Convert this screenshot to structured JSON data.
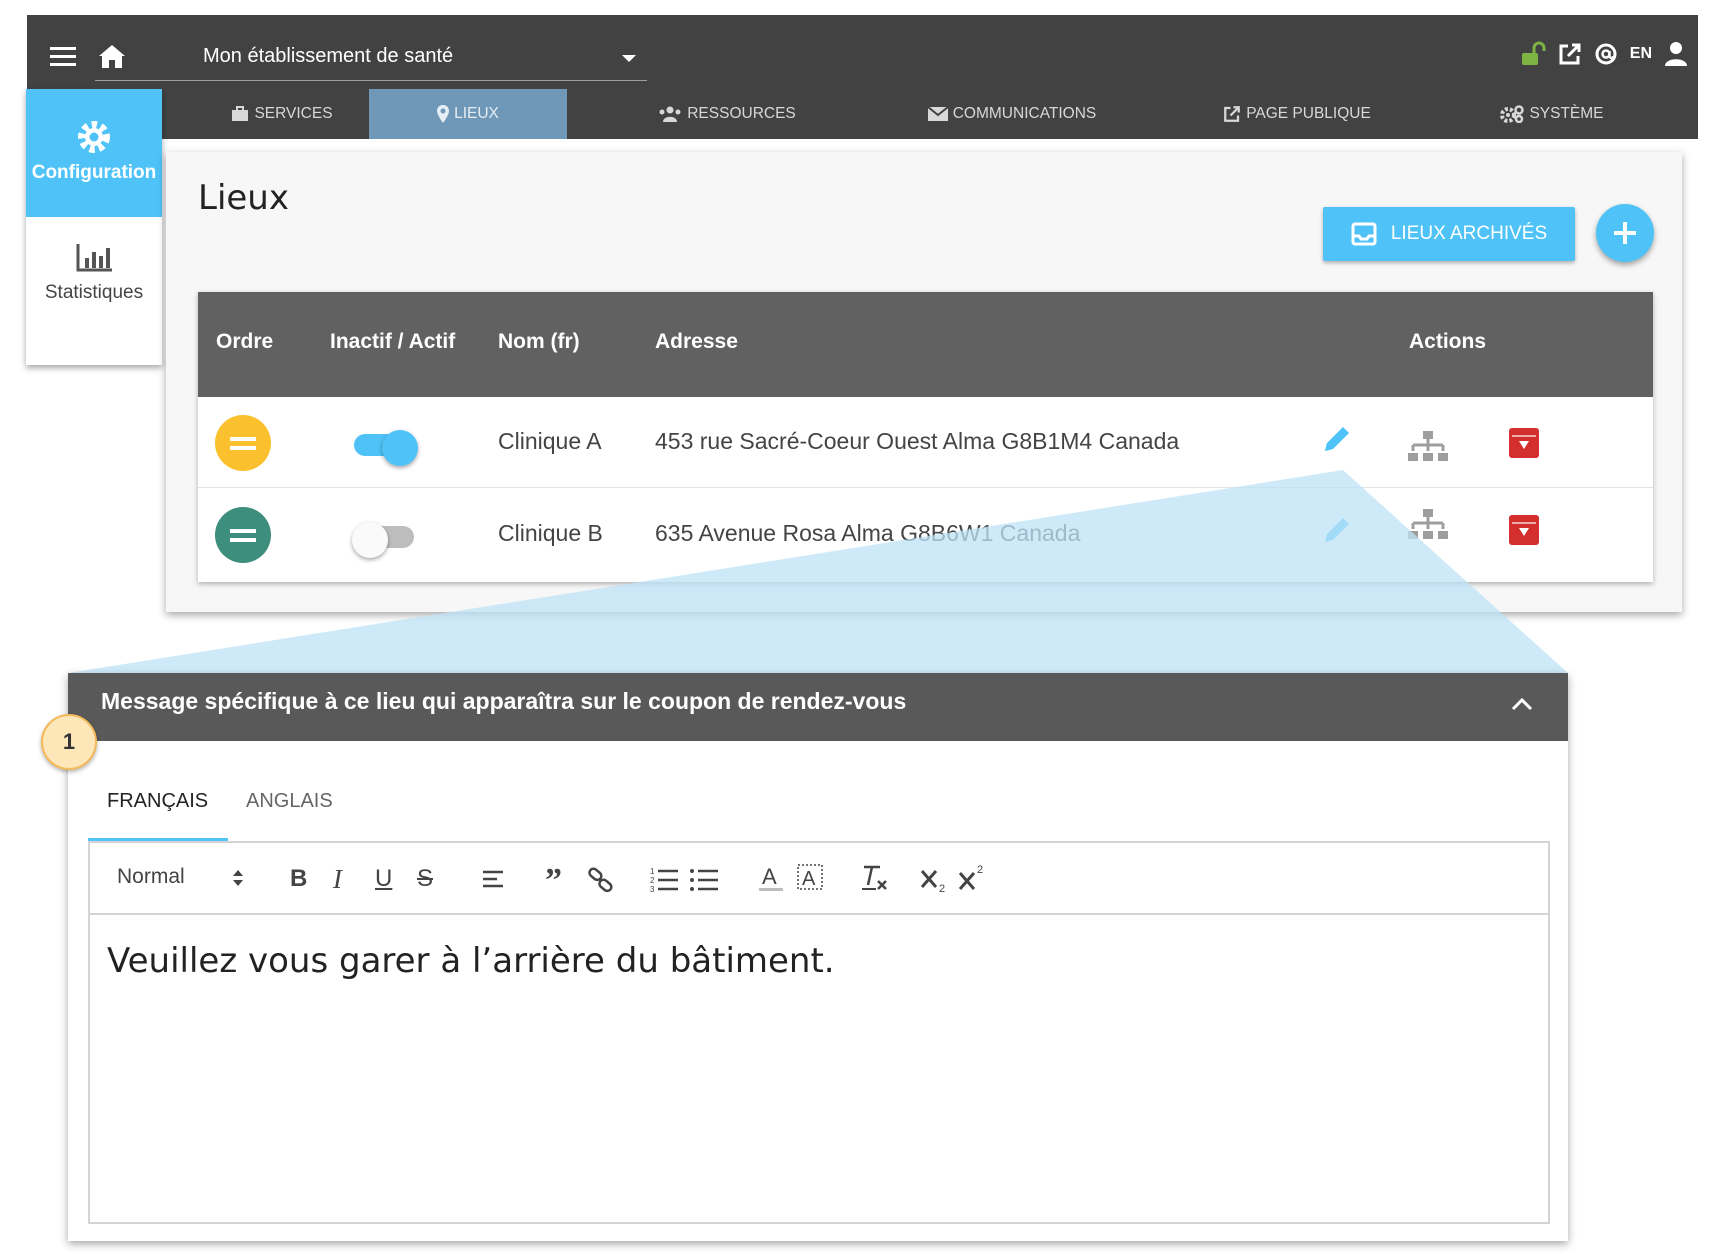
{
  "topbar": {
    "establishment": "Mon établissement de santé",
    "lang_button": "EN"
  },
  "tabs": [
    {
      "label": "SERVICES",
      "icon": "briefcase-icon",
      "active": false
    },
    {
      "label": "LIEUX",
      "icon": "map-marker-icon",
      "active": true
    },
    {
      "label": "RESSOURCES",
      "icon": "users-icon",
      "active": false
    },
    {
      "label": "COMMUNICATIONS",
      "icon": "envelope-icon",
      "active": false
    },
    {
      "label": "PAGE PUBLIQUE",
      "icon": "external-link-icon",
      "active": false
    },
    {
      "label": "SYSTÈME",
      "icon": "cogs-icon",
      "active": false
    }
  ],
  "leftnav": {
    "config_label": "Configuration",
    "stats_label": "Statistiques"
  },
  "page": {
    "title": "Lieux",
    "archived_button": "LIEUX ARCHIVÉS"
  },
  "table": {
    "headers": {
      "order": "Ordre",
      "active": "Inactif / Actif",
      "name": "Nom (fr)",
      "address": "Adresse",
      "actions": "Actions"
    },
    "rows": [
      {
        "name": "Clinique A",
        "address": "453 rue Sacré-Coeur Ouest Alma G8B1M4 Canada",
        "active": true,
        "order_color": "#fbc02d"
      },
      {
        "name": "Clinique B",
        "address": "635 Avenue Rosa Alma G8B6W1 Canada",
        "active": false,
        "order_color": "#3e8e7e"
      }
    ]
  },
  "panel": {
    "step": "1",
    "title": "Message spécifique à ce lieu qui apparaîtra sur le coupon de rendez-vous",
    "tab_fr": "FRANÇAIS",
    "tab_en": "ANGLAIS",
    "format": "Normal",
    "content": "Veuillez vous garer à l’arrière du bâtiment."
  },
  "colors": {
    "accent": "#4fc3f7",
    "header": "#424242",
    "active_tab": "#6f97b7",
    "delete": "#d32f2f",
    "lock": "#7cb342"
  }
}
